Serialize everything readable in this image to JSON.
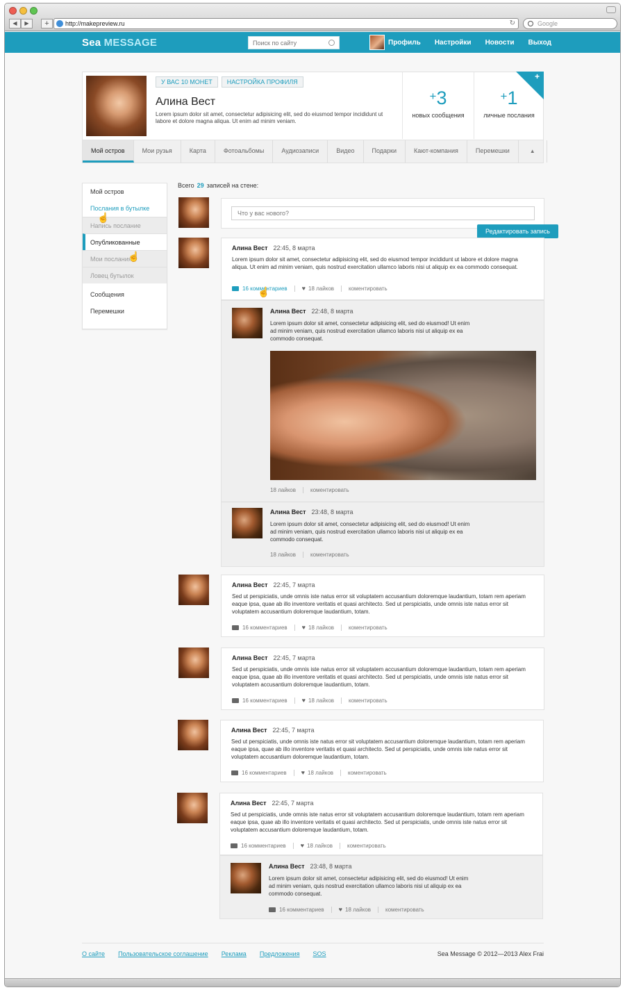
{
  "browser": {
    "url": "http://makepreview.ru",
    "search_placeholder": "Google"
  },
  "header": {
    "logo_part1": "Sea",
    "logo_part2": "MESSAGE",
    "search_placeholder": "Поиск по сайту",
    "menu": [
      "Профиль",
      "Настройки",
      "Новости",
      "Выход"
    ]
  },
  "profile": {
    "coins_badge": "У ВАС 10 МОНЕТ",
    "settings_badge": "НАСТРОЙКА ПРОФИЛЯ",
    "name": "Алина Вест",
    "description": "Lorem ipsum dolor sit amet, consectetur adipisicing elit, sed do eiusmod tempor incididunt ut labore et dolore magna aliqua. Ut enim ad minim veniam.",
    "new_messages_count": "3",
    "new_messages_label": "новых сообщения",
    "personal_count": "1",
    "personal_label": "личные послания",
    "plus_sign": "+",
    "tabs": [
      "Мой остров",
      "Мои рузья",
      "Карта",
      "Фотоальбомы",
      "Аудиозаписи",
      "Видео",
      "Подарки",
      "Кают-компания",
      "Перемешки"
    ],
    "tabs_arrow": "▲"
  },
  "sidebar": {
    "items": [
      "Мой остров",
      "Послания в бутылке"
    ],
    "subitems": [
      "Напись послание",
      "Опубликованные",
      "Мои послания",
      "Ловец бутылок"
    ],
    "bottom": [
      "Сообщения",
      "Перемешки"
    ]
  },
  "wall": {
    "count_before": "Всего",
    "count": "29",
    "count_after": "записей на стене:",
    "new_post_placeholder": "Что у вас нового?",
    "edit_tooltip": "Редактировать запись",
    "posts": [
      {
        "author": "Алина Вест",
        "date": "22:45,  8 марта",
        "text": "Lorem ipsum dolor sit amet, consectetur adipisicing elit, sed do eiusmod tempor incididunt ut labore et dolore magna aliqua. Ut enim ad minim veniam, quis nostrud exercitation ullamco laboris nisi ut aliquip ex ea commodo consequat.",
        "comments": "16 комментариев",
        "likes": "18 лайков",
        "action": "коментировать"
      },
      {
        "author": "Алина Вест",
        "date": "22:45,  7 марта",
        "text": "Sed ut perspiciatis, unde omnis iste natus error sit voluptatem accusantium doloremque laudantium, totam rem aperiam eaque ipsa, quae ab illo inventore veritatis et quasi architecto. Sed ut perspiciatis, unde omnis iste natus error sit voluptatem accusantium doloremque laudantium, totam.",
        "comments": "16 комментариев",
        "likes": "18 лайков",
        "action": "коментировать"
      },
      {
        "author": "Алина Вест",
        "date": "22:45,  7 марта",
        "text": "Sed ut perspiciatis, unde omnis iste natus error sit voluptatem accusantium doloremque laudantium, totam rem aperiam eaque ipsa, quae ab illo inventore veritatis et quasi architecto. Sed ut perspiciatis, unde omnis iste natus error sit voluptatem accusantium doloremque laudantium, totam.",
        "comments": "16 комментариев",
        "likes": "18 лайков",
        "action": "коментировать"
      },
      {
        "author": "Алина Вест",
        "date": "22:45,  7 марта",
        "text": "Sed ut perspiciatis, unde omnis iste natus error sit voluptatem accusantium doloremque laudantium, totam rem aperiam eaque ipsa, quae ab illo inventore veritatis et quasi architecto. Sed ut perspiciatis, unde omnis iste natus error sit voluptatem accusantium doloremque laudantium, totam.",
        "comments": "16 комментариев",
        "likes": "18 лайков",
        "action": "коментировать"
      },
      {
        "author": "Алина Вест",
        "date": "22:45,  7 марта",
        "text": "Sed ut perspiciatis, unde omnis iste natus error sit voluptatem accusantium doloremque laudantium, totam rem aperiam eaque ipsa, quae ab illo inventore veritatis et quasi architecto. Sed ut perspiciatis, unde omnis iste natus error sit voluptatem accusantium doloremque laudantium, totam.",
        "comments": "16 комментариев",
        "likes": "18 лайков",
        "action": "коментировать"
      }
    ],
    "replies": [
      {
        "author": "Алина Вест",
        "date": "22:48,  8 марта",
        "text": "Lorem ipsum dolor sit amet, consectetur adipisicing elit, sed do eiusmod! Ut enim ad minim veniam, quis nostrud exercitation ullamco laboris nisi ut aliquip ex ea commodo consequat.",
        "likes": "18 лайков",
        "action": "коментировать"
      },
      {
        "author": "Алина Вест",
        "date": "23:48,  8 марта",
        "text": "Lorem ipsum dolor sit amet, consectetur adipisicing elit, sed do eiusmod! Ut enim ad minim veniam, quis nostrud exercitation ullamco laboris nisi ut aliquip ex ea commodo consequat.",
        "likes": "18 лайков",
        "action": "коментировать"
      },
      {
        "author": "Алина Вест",
        "date": "23:48,  8 марта",
        "text": "Lorem ipsum dolor sit amet, consectetur adipisicing elit, sed do eiusmod! Ut enim ad minim veniam, quis nostrud exercitation ullamco laboris nisi ut aliquip ex ea commodo consequat.",
        "comments": "16 комментариев",
        "likes": "18 лайков",
        "action": "коментировать"
      }
    ]
  },
  "footer": {
    "links": [
      "О сайте",
      "Пользовательское соглашение",
      "Реклама",
      "Предложения",
      "SOS"
    ],
    "copyright": "Sea Message © 2012—2013 Alex Frai"
  },
  "colors": {
    "accent": "#1e9dbd",
    "background": "#f7f7f7"
  },
  "icons": [
    "search-icon",
    "comment-icon",
    "heart-icon",
    "pencil-icon",
    "hand-cursor-icon",
    "globe-icon",
    "reload-icon"
  ]
}
